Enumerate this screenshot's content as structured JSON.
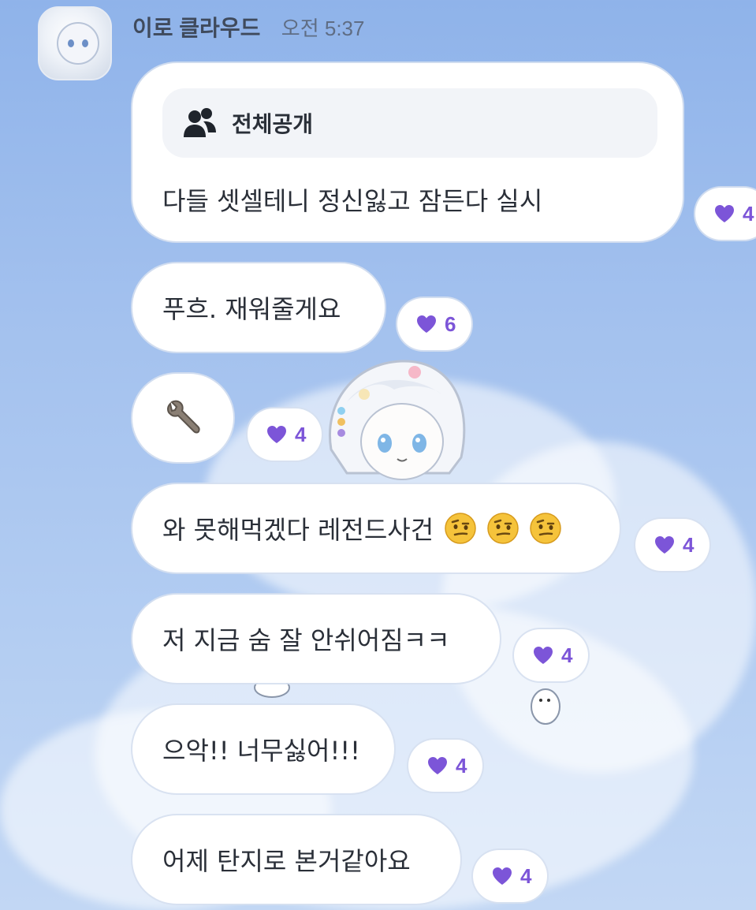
{
  "header": {
    "sender_name": "이로 클라우드",
    "time": "오전 5:37"
  },
  "messages": [
    {
      "visibility_label": "전체공개",
      "visibility_icon": "people-icon",
      "text": "다들 셋셀테니 정신잃고 잠든다 실시",
      "likes": "4"
    },
    {
      "text": "푸흐. 재워줄게요",
      "likes": "6"
    },
    {
      "text": "🔧",
      "likes": "4"
    },
    {
      "text": "와 못해먹겠다 레전드사건",
      "emoji": [
        "raised-eyebrow-face-icon",
        "raised-eyebrow-face-icon",
        "raised-eyebrow-face-icon"
      ],
      "likes": "4"
    },
    {
      "text": "저 지금 숨 잘 안쉬어짐ㅋㅋ",
      "likes": "4"
    },
    {
      "text": "으악!! 너무싫어!!!",
      "likes": "4"
    },
    {
      "text": "어제 탄지로 본거같아요",
      "likes": "4"
    }
  ],
  "colors": {
    "like_accent": "#7c55d8",
    "bubble_bg": "#ffffff",
    "sky": "#a3c1ee"
  }
}
